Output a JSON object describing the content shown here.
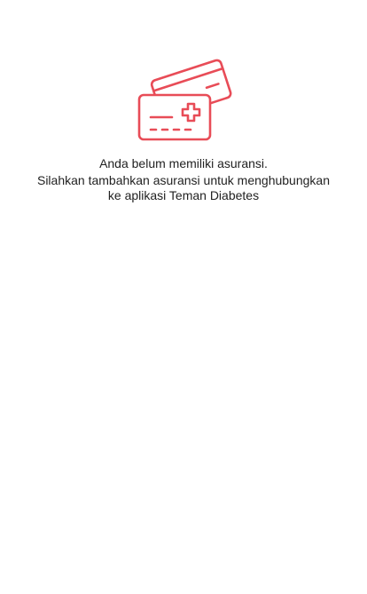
{
  "empty_state": {
    "icon": "insurance-card-icon",
    "accent_color": "#e84c57",
    "title": "Anda belum memiliki asuransi.",
    "message_line1": "Silahkan tambahkan asuransi untuk menghubungkan",
    "message_line2": "ke aplikasi Teman Diabetes"
  }
}
